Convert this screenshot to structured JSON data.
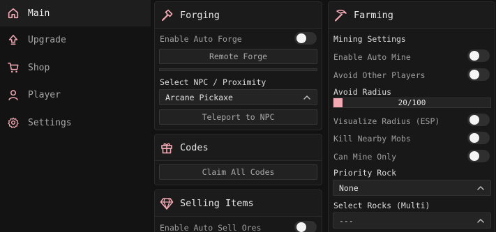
{
  "colors": {
    "accent": "#f2a9b3",
    "background": "#121212",
    "panel": "#181818",
    "sidebar_active": "#1e1e1e"
  },
  "sidebar": {
    "items": [
      {
        "label": "Main",
        "icon": "home-icon",
        "active": true
      },
      {
        "label": "Upgrade",
        "icon": "upgrade-arrow-icon",
        "active": false
      },
      {
        "label": "Shop",
        "icon": "cart-icon",
        "active": false
      },
      {
        "label": "Player",
        "icon": "user-icon",
        "active": false
      },
      {
        "label": "Settings",
        "icon": "gear-icon",
        "active": false
      }
    ]
  },
  "forging": {
    "title": "Forging",
    "icon": "hammer-icon",
    "enable_auto_forge_label": "Enable Auto Forge",
    "enable_auto_forge_on": false,
    "remote_forge_label": "Remote Forge",
    "select_npc_label": "Select NPC / Proximity",
    "npc_value": "Arcane Pickaxe",
    "teleport_label": "Teleport to NPC"
  },
  "codes": {
    "title": "Codes",
    "icon": "gift-icon",
    "claim_label": "Claim All Codes"
  },
  "selling": {
    "title": "Selling Items",
    "icon": "gem-icon",
    "enable_auto_sell_label": "Enable Auto Sell Ores",
    "enable_auto_sell_on": false
  },
  "farming": {
    "title": "Farming",
    "icon": "pickaxe-icon",
    "mining_settings_label": "Mining Settings",
    "enable_auto_mine_label": "Enable Auto Mine",
    "enable_auto_mine_on": false,
    "avoid_players_label": "Avoid Other Players",
    "avoid_players_on": false,
    "avoid_radius_label": "Avoid Radius",
    "avoid_radius_value": 20,
    "avoid_radius_max": 100,
    "avoid_radius_text": "20/100",
    "visualize_label": "Visualize Radius (ESP)",
    "visualize_on": false,
    "kill_mobs_label": "Kill Nearby Mobs",
    "kill_mobs_on": false,
    "can_mine_only_label": "Can Mine Only",
    "can_mine_only_on": false,
    "priority_rock_label": "Priority Rock",
    "priority_rock_value": "None",
    "select_rocks_label": "Select Rocks (Multi)",
    "select_rocks_value": "---"
  }
}
